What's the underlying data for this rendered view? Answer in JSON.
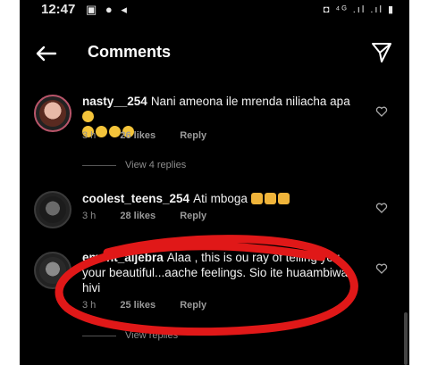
{
  "status": {
    "time": "12:47",
    "left_icons": "▣ ● ◂",
    "right_icons": "◘ ⁴ᴳ .ıl .ıl ▮"
  },
  "header": {
    "title": "Comments",
    "back_icon": "arrow-left-icon",
    "send_icon": "paper-plane-icon"
  },
  "comments": [
    {
      "username": "nasty__254",
      "text": "Nani ameona ile mrenda niliacha apa",
      "time": "3 h",
      "likes": "26 likes",
      "reply": "Reply",
      "view_replies": "View 4 replies"
    },
    {
      "username": "coolest_teens_254",
      "text": "Ati mboga",
      "time": "3 h",
      "likes": "28 likes",
      "reply": "Reply"
    },
    {
      "username": "ement_aljebra",
      "text": "Alaa , this is ou ray of telling you your beautiful...aache feelings. Sio ite huaambiwa hivi",
      "time": "3 h",
      "likes": "25 likes",
      "reply": "Reply",
      "view_replies": "View replies"
    }
  ],
  "colors": {
    "background": "#000000",
    "meta": "#8d8d8d",
    "annotation": "#e01818"
  }
}
